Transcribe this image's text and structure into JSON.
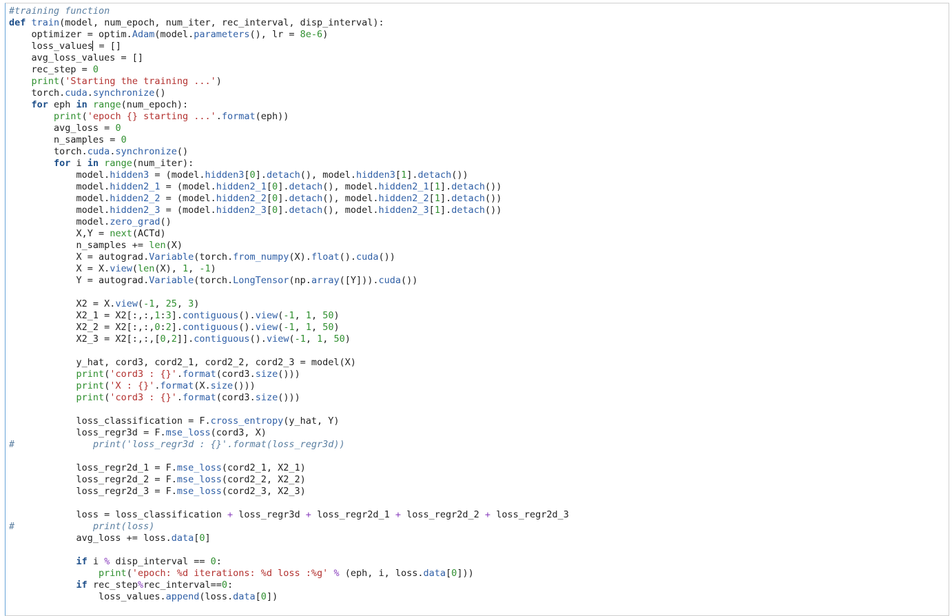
{
  "editor": {
    "cursor_line": 3,
    "lines": [
      [
        {
          "t": "#training function",
          "c": "cm"
        }
      ],
      [
        {
          "t": "def",
          "c": "kw"
        },
        {
          "t": " "
        },
        {
          "t": "train",
          "c": "fn"
        },
        {
          "t": "(model, num_epoch, num_iter, rec_interval, disp_interval):"
        }
      ],
      [
        {
          "t": "    optimizer = optim."
        },
        {
          "t": "Adam",
          "c": "attr"
        },
        {
          "t": "(model."
        },
        {
          "t": "parameters",
          "c": "attr"
        },
        {
          "t": "(), lr = "
        },
        {
          "t": "8e-6",
          "c": "num"
        },
        {
          "t": ")"
        }
      ],
      [
        {
          "t": "    loss_values"
        },
        {
          "t": "",
          "cursor": true
        },
        {
          "t": " = []"
        }
      ],
      [
        {
          "t": "    avg_loss_values = []"
        }
      ],
      [
        {
          "t": "    rec_step = "
        },
        {
          "t": "0",
          "c": "num"
        }
      ],
      [
        {
          "t": "    "
        },
        {
          "t": "print",
          "c": "bi"
        },
        {
          "t": "("
        },
        {
          "t": "'Starting the training ...'",
          "c": "str"
        },
        {
          "t": ")"
        }
      ],
      [
        {
          "t": "    torch."
        },
        {
          "t": "cuda",
          "c": "attr"
        },
        {
          "t": "."
        },
        {
          "t": "synchronize",
          "c": "attr"
        },
        {
          "t": "()"
        }
      ],
      [
        {
          "t": "    "
        },
        {
          "t": "for",
          "c": "kw"
        },
        {
          "t": " eph "
        },
        {
          "t": "in",
          "c": "kw"
        },
        {
          "t": " "
        },
        {
          "t": "range",
          "c": "bi"
        },
        {
          "t": "(num_epoch):"
        }
      ],
      [
        {
          "t": "        "
        },
        {
          "t": "print",
          "c": "bi"
        },
        {
          "t": "("
        },
        {
          "t": "'epoch {} starting ...'",
          "c": "str"
        },
        {
          "t": "."
        },
        {
          "t": "format",
          "c": "attr"
        },
        {
          "t": "(eph))"
        }
      ],
      [
        {
          "t": "        avg_loss = "
        },
        {
          "t": "0",
          "c": "num"
        }
      ],
      [
        {
          "t": "        n_samples = "
        },
        {
          "t": "0",
          "c": "num"
        }
      ],
      [
        {
          "t": "        torch."
        },
        {
          "t": "cuda",
          "c": "attr"
        },
        {
          "t": "."
        },
        {
          "t": "synchronize",
          "c": "attr"
        },
        {
          "t": "()"
        }
      ],
      [
        {
          "t": "        "
        },
        {
          "t": "for",
          "c": "kw"
        },
        {
          "t": " i "
        },
        {
          "t": "in",
          "c": "kw"
        },
        {
          "t": " "
        },
        {
          "t": "range",
          "c": "bi"
        },
        {
          "t": "(num_iter):"
        }
      ],
      [
        {
          "t": "            model."
        },
        {
          "t": "hidden3",
          "c": "attr"
        },
        {
          "t": " = (model."
        },
        {
          "t": "hidden3",
          "c": "attr"
        },
        {
          "t": "["
        },
        {
          "t": "0",
          "c": "num"
        },
        {
          "t": "]."
        },
        {
          "t": "detach",
          "c": "attr"
        },
        {
          "t": "(), model."
        },
        {
          "t": "hidden3",
          "c": "attr"
        },
        {
          "t": "["
        },
        {
          "t": "1",
          "c": "num"
        },
        {
          "t": "]."
        },
        {
          "t": "detach",
          "c": "attr"
        },
        {
          "t": "())"
        }
      ],
      [
        {
          "t": "            model."
        },
        {
          "t": "hidden2_1",
          "c": "attr"
        },
        {
          "t": " = (model."
        },
        {
          "t": "hidden2_1",
          "c": "attr"
        },
        {
          "t": "["
        },
        {
          "t": "0",
          "c": "num"
        },
        {
          "t": "]."
        },
        {
          "t": "detach",
          "c": "attr"
        },
        {
          "t": "(), model."
        },
        {
          "t": "hidden2_1",
          "c": "attr"
        },
        {
          "t": "["
        },
        {
          "t": "1",
          "c": "num"
        },
        {
          "t": "]."
        },
        {
          "t": "detach",
          "c": "attr"
        },
        {
          "t": "())"
        }
      ],
      [
        {
          "t": "            model."
        },
        {
          "t": "hidden2_2",
          "c": "attr"
        },
        {
          "t": " = (model."
        },
        {
          "t": "hidden2_2",
          "c": "attr"
        },
        {
          "t": "["
        },
        {
          "t": "0",
          "c": "num"
        },
        {
          "t": "]."
        },
        {
          "t": "detach",
          "c": "attr"
        },
        {
          "t": "(), model."
        },
        {
          "t": "hidden2_2",
          "c": "attr"
        },
        {
          "t": "["
        },
        {
          "t": "1",
          "c": "num"
        },
        {
          "t": "]."
        },
        {
          "t": "detach",
          "c": "attr"
        },
        {
          "t": "())"
        }
      ],
      [
        {
          "t": "            model."
        },
        {
          "t": "hidden2_3",
          "c": "attr"
        },
        {
          "t": " = (model."
        },
        {
          "t": "hidden2_3",
          "c": "attr"
        },
        {
          "t": "["
        },
        {
          "t": "0",
          "c": "num"
        },
        {
          "t": "]."
        },
        {
          "t": "detach",
          "c": "attr"
        },
        {
          "t": "(), model."
        },
        {
          "t": "hidden2_3",
          "c": "attr"
        },
        {
          "t": "["
        },
        {
          "t": "1",
          "c": "num"
        },
        {
          "t": "]."
        },
        {
          "t": "detach",
          "c": "attr"
        },
        {
          "t": "())"
        }
      ],
      [
        {
          "t": "            model."
        },
        {
          "t": "zero_grad",
          "c": "attr"
        },
        {
          "t": "()"
        }
      ],
      [
        {
          "t": "            X,Y = "
        },
        {
          "t": "next",
          "c": "bi"
        },
        {
          "t": "(ACTd)"
        }
      ],
      [
        {
          "t": "            n_samples += "
        },
        {
          "t": "len",
          "c": "bi"
        },
        {
          "t": "(X)"
        }
      ],
      [
        {
          "t": "            X = autograd."
        },
        {
          "t": "Variable",
          "c": "attr"
        },
        {
          "t": "(torch."
        },
        {
          "t": "from_numpy",
          "c": "attr"
        },
        {
          "t": "(X)."
        },
        {
          "t": "float",
          "c": "attr"
        },
        {
          "t": "()."
        },
        {
          "t": "cuda",
          "c": "attr"
        },
        {
          "t": "())"
        }
      ],
      [
        {
          "t": "            X = X."
        },
        {
          "t": "view",
          "c": "attr"
        },
        {
          "t": "("
        },
        {
          "t": "len",
          "c": "bi"
        },
        {
          "t": "(X), "
        },
        {
          "t": "1",
          "c": "num"
        },
        {
          "t": ", "
        },
        {
          "t": "-1",
          "c": "num"
        },
        {
          "t": ")"
        }
      ],
      [
        {
          "t": "            Y = autograd."
        },
        {
          "t": "Variable",
          "c": "attr"
        },
        {
          "t": "(torch."
        },
        {
          "t": "LongTensor",
          "c": "attr"
        },
        {
          "t": "(np."
        },
        {
          "t": "array",
          "c": "attr"
        },
        {
          "t": "([Y]))."
        },
        {
          "t": "cuda",
          "c": "attr"
        },
        {
          "t": "())"
        }
      ],
      [
        {
          "t": ""
        }
      ],
      [
        {
          "t": "            X2 = X."
        },
        {
          "t": "view",
          "c": "attr"
        },
        {
          "t": "("
        },
        {
          "t": "-1",
          "c": "num"
        },
        {
          "t": ", "
        },
        {
          "t": "25",
          "c": "num"
        },
        {
          "t": ", "
        },
        {
          "t": "3",
          "c": "num"
        },
        {
          "t": ")"
        }
      ],
      [
        {
          "t": "            X2_1 = X2[:,:,"
        },
        {
          "t": "1",
          "c": "num"
        },
        {
          "t": ":"
        },
        {
          "t": "3",
          "c": "num"
        },
        {
          "t": "]."
        },
        {
          "t": "contiguous",
          "c": "attr"
        },
        {
          "t": "()."
        },
        {
          "t": "view",
          "c": "attr"
        },
        {
          "t": "("
        },
        {
          "t": "-1",
          "c": "num"
        },
        {
          "t": ", "
        },
        {
          "t": "1",
          "c": "num"
        },
        {
          "t": ", "
        },
        {
          "t": "50",
          "c": "num"
        },
        {
          "t": ")"
        }
      ],
      [
        {
          "t": "            X2_2 = X2[:,:,"
        },
        {
          "t": "0",
          "c": "num"
        },
        {
          "t": ":"
        },
        {
          "t": "2",
          "c": "num"
        },
        {
          "t": "]."
        },
        {
          "t": "contiguous",
          "c": "attr"
        },
        {
          "t": "()."
        },
        {
          "t": "view",
          "c": "attr"
        },
        {
          "t": "("
        },
        {
          "t": "-1",
          "c": "num"
        },
        {
          "t": ", "
        },
        {
          "t": "1",
          "c": "num"
        },
        {
          "t": ", "
        },
        {
          "t": "50",
          "c": "num"
        },
        {
          "t": ")"
        }
      ],
      [
        {
          "t": "            X2_3 = X2[:,:,["
        },
        {
          "t": "0",
          "c": "num"
        },
        {
          "t": ","
        },
        {
          "t": "2",
          "c": "num"
        },
        {
          "t": "]]."
        },
        {
          "t": "contiguous",
          "c": "attr"
        },
        {
          "t": "()."
        },
        {
          "t": "view",
          "c": "attr"
        },
        {
          "t": "("
        },
        {
          "t": "-1",
          "c": "num"
        },
        {
          "t": ", "
        },
        {
          "t": "1",
          "c": "num"
        },
        {
          "t": ", "
        },
        {
          "t": "50",
          "c": "num"
        },
        {
          "t": ")"
        }
      ],
      [
        {
          "t": ""
        }
      ],
      [
        {
          "t": "            y_hat, cord3, cord2_1, cord2_2, cord2_3 = model(X)"
        }
      ],
      [
        {
          "t": "            "
        },
        {
          "t": "print",
          "c": "bi"
        },
        {
          "t": "("
        },
        {
          "t": "'cord3 : {}'",
          "c": "str"
        },
        {
          "t": "."
        },
        {
          "t": "format",
          "c": "attr"
        },
        {
          "t": "(cord3."
        },
        {
          "t": "size",
          "c": "attr"
        },
        {
          "t": "()))"
        }
      ],
      [
        {
          "t": "            "
        },
        {
          "t": "print",
          "c": "bi"
        },
        {
          "t": "("
        },
        {
          "t": "'X : {}'",
          "c": "str"
        },
        {
          "t": "."
        },
        {
          "t": "format",
          "c": "attr"
        },
        {
          "t": "(X."
        },
        {
          "t": "size",
          "c": "attr"
        },
        {
          "t": "()))"
        }
      ],
      [
        {
          "t": "            "
        },
        {
          "t": "print",
          "c": "bi"
        },
        {
          "t": "("
        },
        {
          "t": "'cord3 : {}'",
          "c": "str"
        },
        {
          "t": "."
        },
        {
          "t": "format",
          "c": "attr"
        },
        {
          "t": "(cord3."
        },
        {
          "t": "size",
          "c": "attr"
        },
        {
          "t": "()))"
        }
      ],
      [
        {
          "t": ""
        }
      ],
      [
        {
          "t": "            loss_classification = F."
        },
        {
          "t": "cross_entropy",
          "c": "attr"
        },
        {
          "t": "(y_hat, Y)"
        }
      ],
      [
        {
          "t": "            loss_regr3d = F."
        },
        {
          "t": "mse_loss",
          "c": "attr"
        },
        {
          "t": "(cord3, X)"
        }
      ],
      [
        {
          "t": "#",
          "c": "cm"
        },
        {
          "t": "              "
        },
        {
          "t": "print('loss_regr3d : {}'.format(loss_regr3d))",
          "c": "cm"
        }
      ],
      [
        {
          "t": ""
        }
      ],
      [
        {
          "t": "            loss_regr2d_1 = F."
        },
        {
          "t": "mse_loss",
          "c": "attr"
        },
        {
          "t": "(cord2_1, X2_1)"
        }
      ],
      [
        {
          "t": "            loss_regr2d_2 = F."
        },
        {
          "t": "mse_loss",
          "c": "attr"
        },
        {
          "t": "(cord2_2, X2_2)"
        }
      ],
      [
        {
          "t": "            loss_regr2d_3 = F."
        },
        {
          "t": "mse_loss",
          "c": "attr"
        },
        {
          "t": "(cord2_3, X2_3)"
        }
      ],
      [
        {
          "t": ""
        }
      ],
      [
        {
          "t": "            loss = loss_classification "
        },
        {
          "t": "+",
          "c": "op"
        },
        {
          "t": " loss_regr3d "
        },
        {
          "t": "+",
          "c": "op"
        },
        {
          "t": " loss_regr2d_1 "
        },
        {
          "t": "+",
          "c": "op"
        },
        {
          "t": " loss_regr2d_2 "
        },
        {
          "t": "+",
          "c": "op"
        },
        {
          "t": " loss_regr2d_3"
        }
      ],
      [
        {
          "t": "#",
          "c": "cm"
        },
        {
          "t": "              "
        },
        {
          "t": "print(loss)",
          "c": "cm"
        }
      ],
      [
        {
          "t": "            avg_loss += loss."
        },
        {
          "t": "data",
          "c": "attr"
        },
        {
          "t": "["
        },
        {
          "t": "0",
          "c": "num"
        },
        {
          "t": "]"
        }
      ],
      [
        {
          "t": ""
        }
      ],
      [
        {
          "t": "            "
        },
        {
          "t": "if",
          "c": "kw"
        },
        {
          "t": " i "
        },
        {
          "t": "%",
          "c": "op"
        },
        {
          "t": " disp_interval == "
        },
        {
          "t": "0",
          "c": "num"
        },
        {
          "t": ":"
        }
      ],
      [
        {
          "t": "                "
        },
        {
          "t": "print",
          "c": "bi"
        },
        {
          "t": "("
        },
        {
          "t": "'epoch: %d iterations: %d loss :%g'",
          "c": "str"
        },
        {
          "t": " "
        },
        {
          "t": "%",
          "c": "op"
        },
        {
          "t": " (eph, i, loss."
        },
        {
          "t": "data",
          "c": "attr"
        },
        {
          "t": "["
        },
        {
          "t": "0",
          "c": "num"
        },
        {
          "t": "]))"
        }
      ],
      [
        {
          "t": "            "
        },
        {
          "t": "if",
          "c": "kw"
        },
        {
          "t": " rec_step"
        },
        {
          "t": "%",
          "c": "op"
        },
        {
          "t": "rec_interval=="
        },
        {
          "t": "0",
          "c": "num"
        },
        {
          "t": ":"
        }
      ],
      [
        {
          "t": "                loss_values."
        },
        {
          "t": "append",
          "c": "attr"
        },
        {
          "t": "(loss."
        },
        {
          "t": "data",
          "c": "attr"
        },
        {
          "t": "["
        },
        {
          "t": "0",
          "c": "num"
        },
        {
          "t": "])"
        }
      ]
    ]
  }
}
